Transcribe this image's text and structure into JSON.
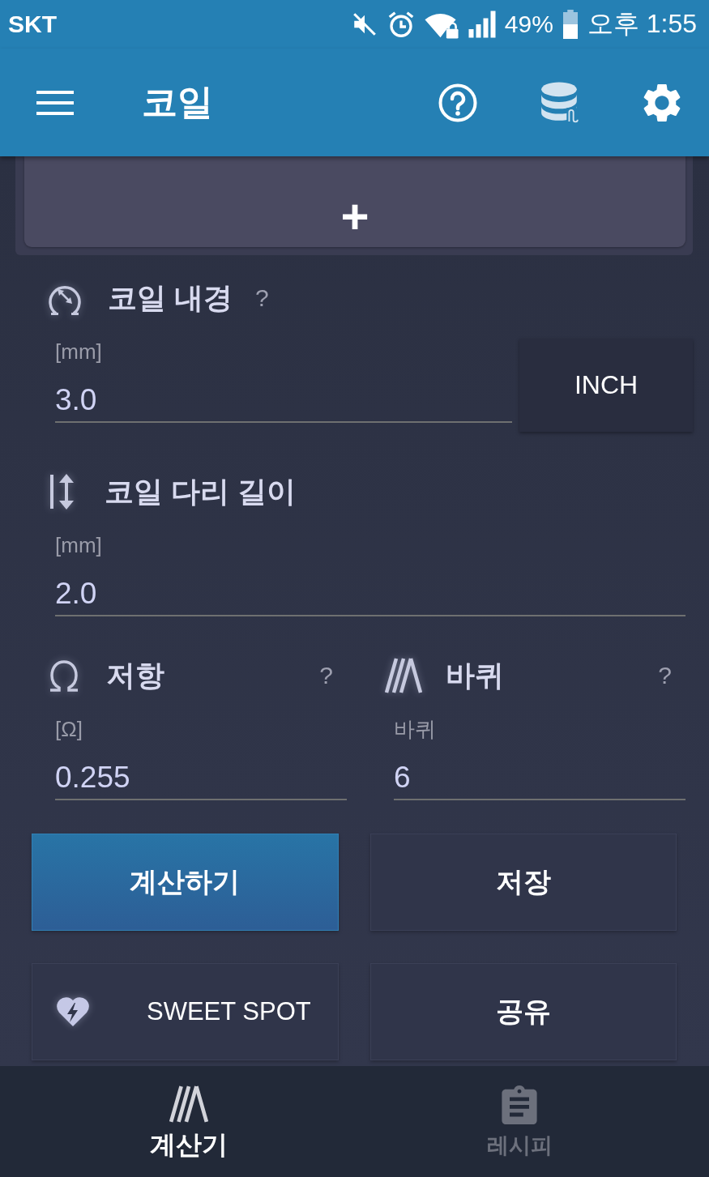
{
  "status_bar": {
    "carrier": "SKT",
    "battery": "49%",
    "time": "오후 1:55"
  },
  "app_bar": {
    "title": "코일"
  },
  "add_card": {
    "label": "+"
  },
  "inner_diameter": {
    "label": "코일 내경",
    "help": "?",
    "unit": "[mm]",
    "value": "3.0",
    "unit_button": "INCH"
  },
  "leg_length": {
    "label": "코일 다리 길이",
    "unit": "[mm]",
    "value": "2.0"
  },
  "resistance": {
    "label": "저항",
    "help": "?",
    "unit": "[Ω]",
    "value": "0.255"
  },
  "wraps": {
    "label": "바퀴",
    "help": "?",
    "unit": "바퀴",
    "value": "6"
  },
  "actions": [
    {
      "kind": "primary",
      "label": "계산하기"
    },
    {
      "kind": "plain",
      "label": "저장"
    },
    {
      "kind": "icon",
      "label": "SWEET SPOT"
    },
    {
      "kind": "plain",
      "label": "공유"
    }
  ],
  "bottom_nav": [
    {
      "label": "계산기",
      "selected": true
    },
    {
      "label": "레시피",
      "selected": false
    }
  ]
}
